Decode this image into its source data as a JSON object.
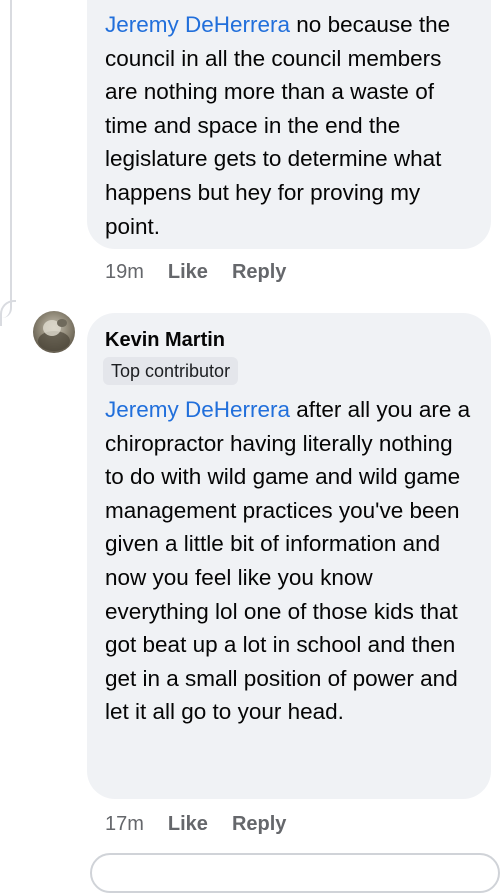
{
  "comments": [
    {
      "mention": "Jeremy DeHerrera",
      "text": " no because the council in all the council members are nothing more than a waste of time and space in the end the legislature gets to determine what happens but hey for proving my point.",
      "time": "19m",
      "like_label": "Like",
      "reply_label": "Reply"
    },
    {
      "author": "Kevin Martin",
      "badge": "Top contributor",
      "avatar_icon": "user-avatar",
      "mention": "Jeremy DeHerrera",
      "text": " after all you are a chiropractor having literally nothing to do with wild game and wild game management practices you've been given a little bit of information and now you feel like you know everything lol one of those kids that got beat up a lot in school and then get in a small position of power and let it all go to your head.",
      "time": "17m",
      "like_label": "Like",
      "reply_label": "Reply"
    }
  ],
  "colors": {
    "mention": "#216fdb",
    "bubble": "#f0f2f5",
    "meta": "#65676b"
  }
}
